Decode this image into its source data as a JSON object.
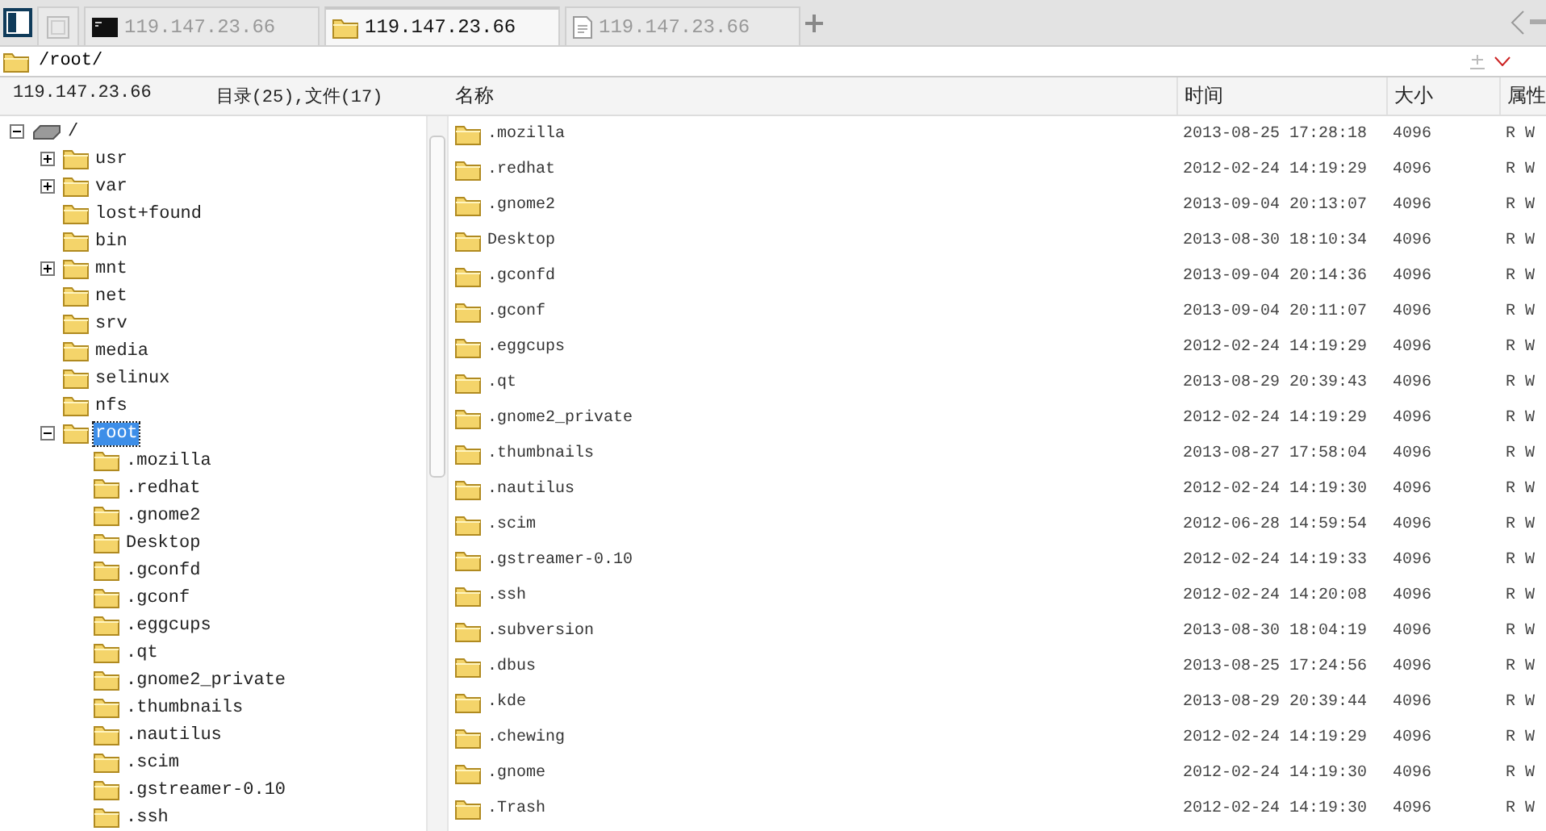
{
  "tabs": [
    {
      "kind": "blank",
      "selected": false
    },
    {
      "kind": "terminal",
      "label": "119.147.23.66",
      "selected": false
    },
    {
      "kind": "folder",
      "label": "119.147.23.66",
      "selected": true
    },
    {
      "kind": "document",
      "label": "119.147.23.66",
      "selected": false
    }
  ],
  "address": {
    "value": "/root/"
  },
  "info": {
    "host": "119.147.23.66",
    "counts": "目录(25),文件(17)"
  },
  "columns": [
    "名称",
    "时间",
    "大小",
    "属性"
  ],
  "tree": [
    {
      "kind": "drive",
      "label": "/",
      "expanded": true,
      "selected": false,
      "children": [
        {
          "kind": "folder",
          "label": "usr",
          "expanded": false,
          "selected": false
        },
        {
          "kind": "folder",
          "label": "var",
          "expanded": false,
          "selected": false
        },
        {
          "kind": "folder",
          "label": "lost+found",
          "selected": false
        },
        {
          "kind": "folder",
          "label": "bin",
          "selected": false
        },
        {
          "kind": "folder",
          "label": "mnt",
          "expanded": false,
          "selected": false
        },
        {
          "kind": "folder",
          "label": "net",
          "selected": false
        },
        {
          "kind": "folder",
          "label": "srv",
          "selected": false
        },
        {
          "kind": "folder",
          "label": "media",
          "selected": false
        },
        {
          "kind": "folder",
          "label": "selinux",
          "selected": false
        },
        {
          "kind": "folder",
          "label": "nfs",
          "selected": false
        },
        {
          "kind": "folder",
          "label": "root",
          "expanded": true,
          "selected": true,
          "children": [
            {
              "kind": "folder",
              "label": ".mozilla",
              "selected": false
            },
            {
              "kind": "folder",
              "label": ".redhat",
              "selected": false
            },
            {
              "kind": "folder",
              "label": ".gnome2",
              "selected": false
            },
            {
              "kind": "folder",
              "label": "Desktop",
              "selected": false
            },
            {
              "kind": "folder",
              "label": ".gconfd",
              "selected": false
            },
            {
              "kind": "folder",
              "label": ".gconf",
              "selected": false
            },
            {
              "kind": "folder",
              "label": ".eggcups",
              "selected": false
            },
            {
              "kind": "folder",
              "label": ".qt",
              "selected": false
            },
            {
              "kind": "folder",
              "label": ".gnome2_private",
              "selected": false
            },
            {
              "kind": "folder",
              "label": ".thumbnails",
              "selected": false
            },
            {
              "kind": "folder",
              "label": ".nautilus",
              "selected": false
            },
            {
              "kind": "folder",
              "label": ".scim",
              "selected": false
            },
            {
              "kind": "folder",
              "label": ".gstreamer-0.10",
              "selected": false
            },
            {
              "kind": "folder",
              "label": ".ssh",
              "selected": false
            }
          ]
        }
      ]
    }
  ],
  "files": [
    {
      "name": ".mozilla",
      "time": "2013-08-25 17:28:18",
      "size": "4096",
      "attr": "R W"
    },
    {
      "name": ".redhat",
      "time": "2012-02-24 14:19:29",
      "size": "4096",
      "attr": "R W"
    },
    {
      "name": ".gnome2",
      "time": "2013-09-04 20:13:07",
      "size": "4096",
      "attr": "R W"
    },
    {
      "name": "Desktop",
      "time": "2013-08-30 18:10:34",
      "size": "4096",
      "attr": "R W"
    },
    {
      "name": ".gconfd",
      "time": "2013-09-04 20:14:36",
      "size": "4096",
      "attr": "R W"
    },
    {
      "name": ".gconf",
      "time": "2013-09-04 20:11:07",
      "size": "4096",
      "attr": "R W"
    },
    {
      "name": ".eggcups",
      "time": "2012-02-24 14:19:29",
      "size": "4096",
      "attr": "R W"
    },
    {
      "name": ".qt",
      "time": "2013-08-29 20:39:43",
      "size": "4096",
      "attr": "R W"
    },
    {
      "name": ".gnome2_private",
      "time": "2012-02-24 14:19:29",
      "size": "4096",
      "attr": "R W"
    },
    {
      "name": ".thumbnails",
      "time": "2013-08-27 17:58:04",
      "size": "4096",
      "attr": "R W"
    },
    {
      "name": ".nautilus",
      "time": "2012-02-24 14:19:30",
      "size": "4096",
      "attr": "R W"
    },
    {
      "name": ".scim",
      "time": "2012-06-28 14:59:54",
      "size": "4096",
      "attr": "R W"
    },
    {
      "name": ".gstreamer-0.10",
      "time": "2012-02-24 14:19:33",
      "size": "4096",
      "attr": "R W"
    },
    {
      "name": ".ssh",
      "time": "2012-02-24 14:20:08",
      "size": "4096",
      "attr": "R W"
    },
    {
      "name": ".subversion",
      "time": "2013-08-30 18:04:19",
      "size": "4096",
      "attr": "R W"
    },
    {
      "name": ".dbus",
      "time": "2013-08-25 17:24:56",
      "size": "4096",
      "attr": "R W"
    },
    {
      "name": ".kde",
      "time": "2013-08-29 20:39:44",
      "size": "4096",
      "attr": "R W"
    },
    {
      "name": ".chewing",
      "time": "2012-02-24 14:19:29",
      "size": "4096",
      "attr": "R W"
    },
    {
      "name": ".gnome",
      "time": "2012-02-24 14:19:30",
      "size": "4096",
      "attr": "R W"
    },
    {
      "name": ".Trash",
      "time": "2012-02-24 14:19:30",
      "size": "4096",
      "attr": "R W"
    }
  ]
}
